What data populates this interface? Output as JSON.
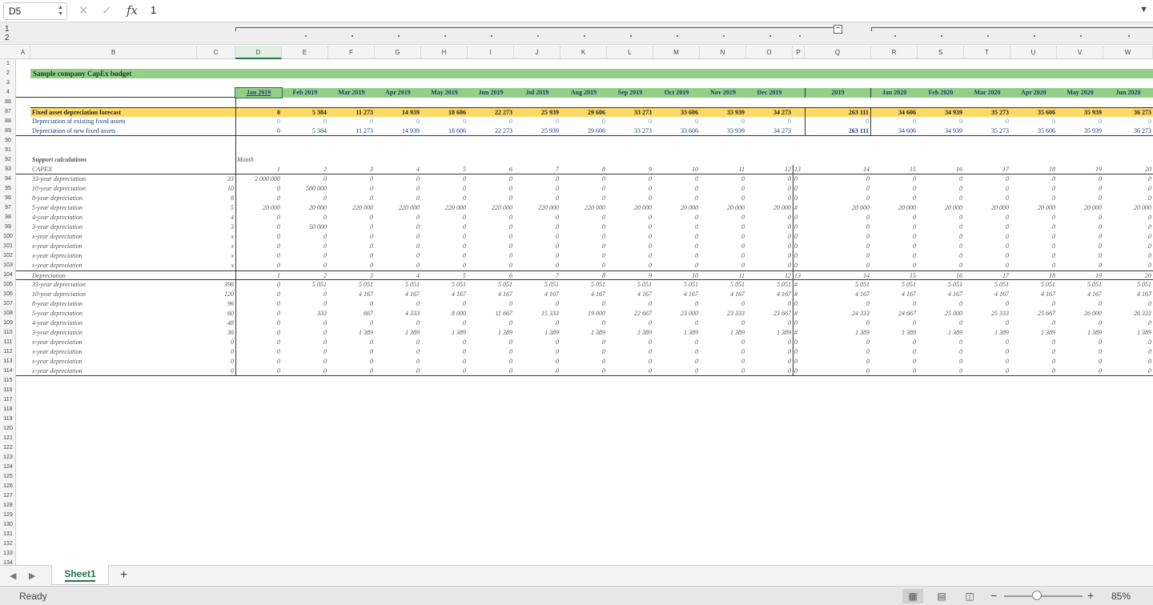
{
  "formula_bar": {
    "name_box": "D5",
    "formula": "1",
    "fx": "fx"
  },
  "outline": {
    "levels": [
      "1",
      "2"
    ],
    "collapse_symbol": "−"
  },
  "columns": [
    "A",
    "B",
    "C",
    "D",
    "E",
    "F",
    "G",
    "H",
    "I",
    "J",
    "K",
    "L",
    "M",
    "N",
    "O",
    "P",
    "Q",
    "R",
    "S",
    "T",
    "U",
    "V",
    "W"
  ],
  "active_column": "D",
  "rows_top": [
    "1",
    "2",
    "3",
    "4"
  ],
  "title": "Sample company CapEx budget",
  "months": [
    "Jan 2019",
    "Feb 2019",
    "Mar 2019",
    "Apr 2019",
    "May 2019",
    "Jun 2019",
    "Jul 2019",
    "Aug 2019",
    "Sep 2019",
    "Oct 2019",
    "Nov 2019",
    "Dec 2019",
    "",
    "2019",
    "Jan 2020",
    "Feb 2020",
    "Mar 2020",
    "Apr 2020",
    "May 2020",
    "Jun 2020"
  ],
  "summary": [
    {
      "row": "87",
      "label": "Fixed asset depreciation forecast",
      "values": [
        "0",
        "5 384",
        "11 273",
        "14 939",
        "18 606",
        "22 273",
        "25 939",
        "29 606",
        "33 273",
        "33 606",
        "33 939",
        "34 273",
        "",
        "263 111",
        "34 606",
        "34 939",
        "35 273",
        "35 606",
        "35 939",
        "36 273"
      ]
    },
    {
      "row": "88",
      "label": "Depreciation of existing fixed assets",
      "values": [
        "0",
        "0",
        "0",
        "0",
        "0",
        "0",
        "0",
        "0",
        "0",
        "0",
        "0",
        "0",
        "",
        "0",
        "0",
        "0",
        "0",
        "0",
        "0",
        "0"
      ]
    },
    {
      "row": "89",
      "label": "Depreciation of new fixed assets",
      "values": [
        "0",
        "5 384",
        "11 273",
        "14 939",
        "18 606",
        "22 273",
        "25 939",
        "29 606",
        "33 273",
        "33 606",
        "33 939",
        "34 273",
        "",
        "263 111",
        "34 606",
        "34 939",
        "35 273",
        "35 606",
        "35 939",
        "36 273"
      ]
    }
  ],
  "support": {
    "header_label": "Support calculations",
    "month_label": "Month",
    "capex_label": "CAPEX",
    "depr_label": "Depreciation",
    "month_numbers": [
      "1",
      "2",
      "3",
      "4",
      "5",
      "6",
      "7",
      "8",
      "9",
      "10",
      "11",
      "12",
      "13",
      "14",
      "15",
      "16",
      "17",
      "18",
      "19",
      "20"
    ],
    "capex_rows": [
      {
        "row": "94",
        "label": "33-year depreciation",
        "c": "33",
        "values": [
          "2 000 000",
          "0",
          "0",
          "0",
          "0",
          "0",
          "0",
          "0",
          "0",
          "0",
          "0",
          "0",
          "0",
          "0",
          "0",
          "0",
          "0",
          "0",
          "0",
          "0"
        ]
      },
      {
        "row": "95",
        "label": "10-year depreciation",
        "c": "10",
        "values": [
          "0",
          "500 000",
          "0",
          "0",
          "0",
          "0",
          "0",
          "0",
          "0",
          "0",
          "0",
          "0",
          "0",
          "0",
          "0",
          "0",
          "0",
          "0",
          "0",
          "0"
        ]
      },
      {
        "row": "96",
        "label": "8-year depreciation",
        "c": "8",
        "values": [
          "0",
          "0",
          "0",
          "0",
          "0",
          "0",
          "0",
          "0",
          "0",
          "0",
          "0",
          "0",
          "0",
          "0",
          "0",
          "0",
          "0",
          "0",
          "0",
          "0"
        ]
      },
      {
        "row": "97",
        "label": "5-year depreciation",
        "c": "5",
        "values": [
          "20 000",
          "20 000",
          "220 000",
          "220 000",
          "220 000",
          "220 000",
          "220 000",
          "220 000",
          "20 000",
          "20 000",
          "20 000",
          "20 000",
          "#",
          "20 000",
          "20 000",
          "20 000",
          "20 000",
          "20 000",
          "20 000",
          "20 000"
        ]
      },
      {
        "row": "98",
        "label": "4-year depreciation",
        "c": "4",
        "values": [
          "0",
          "0",
          "0",
          "0",
          "0",
          "0",
          "0",
          "0",
          "0",
          "0",
          "0",
          "0",
          "0",
          "0",
          "0",
          "0",
          "0",
          "0",
          "0",
          "0"
        ]
      },
      {
        "row": "99",
        "label": "3-year depreciation",
        "c": "3",
        "values": [
          "0",
          "50 000",
          "0",
          "0",
          "0",
          "0",
          "0",
          "0",
          "0",
          "0",
          "0",
          "0",
          "0",
          "0",
          "0",
          "0",
          "0",
          "0",
          "0",
          "0"
        ]
      },
      {
        "row": "100",
        "label": "x-year depreciation",
        "c": "x",
        "values": [
          "0",
          "0",
          "0",
          "0",
          "0",
          "0",
          "0",
          "0",
          "0",
          "0",
          "0",
          "0",
          "0",
          "0",
          "0",
          "0",
          "0",
          "0",
          "0",
          "0"
        ]
      },
      {
        "row": "101",
        "label": "x-year depreciation",
        "c": "x",
        "values": [
          "0",
          "0",
          "0",
          "0",
          "0",
          "0",
          "0",
          "0",
          "0",
          "0",
          "0",
          "0",
          "0",
          "0",
          "0",
          "0",
          "0",
          "0",
          "0",
          "0"
        ]
      },
      {
        "row": "102",
        "label": "x-year depreciation",
        "c": "x",
        "values": [
          "0",
          "0",
          "0",
          "0",
          "0",
          "0",
          "0",
          "0",
          "0",
          "0",
          "0",
          "0",
          "0",
          "0",
          "0",
          "0",
          "0",
          "0",
          "0",
          "0"
        ]
      },
      {
        "row": "103",
        "label": "x-year depreciation",
        "c": "x",
        "values": [
          "0",
          "0",
          "0",
          "0",
          "0",
          "0",
          "0",
          "0",
          "0",
          "0",
          "0",
          "0",
          "0",
          "0",
          "0",
          "0",
          "0",
          "0",
          "0",
          "0"
        ]
      }
    ],
    "depr_rows": [
      {
        "row": "105",
        "label": "33-year depreciation",
        "c": "396",
        "values": [
          "0",
          "5 051",
          "5 051",
          "5 051",
          "5 051",
          "5 051",
          "5 051",
          "5 051",
          "5 051",
          "5 051",
          "5 051",
          "5 051",
          "#",
          "5 051",
          "5 051",
          "5 051",
          "5 051",
          "5 051",
          "5 051",
          "5 051"
        ]
      },
      {
        "row": "106",
        "label": "10-year depreciation",
        "c": "120",
        "values": [
          "0",
          "0",
          "4 167",
          "4 167",
          "4 167",
          "4 167",
          "4 167",
          "4 167",
          "4 167",
          "4 167",
          "4 167",
          "4 167",
          "#",
          "4 167",
          "4 167",
          "4 167",
          "4 167",
          "4 167",
          "4 167",
          "4 167"
        ]
      },
      {
        "row": "107",
        "label": "8-year depreciation",
        "c": "96",
        "values": [
          "0",
          "0",
          "0",
          "0",
          "0",
          "0",
          "0",
          "0",
          "0",
          "0",
          "0",
          "0",
          "0",
          "0",
          "0",
          "0",
          "0",
          "0",
          "0",
          "0"
        ]
      },
      {
        "row": "108",
        "label": "5-year depreciation",
        "c": "60",
        "values": [
          "0",
          "333",
          "667",
          "4 333",
          "8 000",
          "11 667",
          "15 333",
          "19 000",
          "22 667",
          "23 000",
          "23 333",
          "23 667",
          "#",
          "24 333",
          "24 667",
          "25 000",
          "25 333",
          "25 667",
          "26 000",
          "26 333"
        ]
      },
      {
        "row": "109",
        "label": "4-year depreciation",
        "c": "48",
        "values": [
          "0",
          "0",
          "0",
          "0",
          "0",
          "0",
          "0",
          "0",
          "0",
          "0",
          "0",
          "0",
          "0",
          "0",
          "0",
          "0",
          "0",
          "0",
          "0",
          "0"
        ]
      },
      {
        "row": "110",
        "label": "3-year depreciation",
        "c": "36",
        "values": [
          "0",
          "0",
          "1 389",
          "1 389",
          "1 389",
          "1 389",
          "1 389",
          "1 389",
          "1 389",
          "1 389",
          "1 389",
          "1 389",
          "#",
          "1 389",
          "1 389",
          "1 389",
          "1 389",
          "1 389",
          "1 389",
          "1 389"
        ]
      },
      {
        "row": "111",
        "label": "x-year depreciation",
        "c": "0",
        "values": [
          "0",
          "0",
          "0",
          "0",
          "0",
          "0",
          "0",
          "0",
          "0",
          "0",
          "0",
          "0",
          "0",
          "0",
          "0",
          "0",
          "0",
          "0",
          "0",
          "0"
        ]
      },
      {
        "row": "112",
        "label": "x-year depreciation",
        "c": "0",
        "values": [
          "0",
          "0",
          "0",
          "0",
          "0",
          "0",
          "0",
          "0",
          "0",
          "0",
          "0",
          "0",
          "0",
          "0",
          "0",
          "0",
          "0",
          "0",
          "0",
          "0"
        ]
      },
      {
        "row": "113",
        "label": "x-year depreciation",
        "c": "0",
        "values": [
          "0",
          "0",
          "0",
          "0",
          "0",
          "0",
          "0",
          "0",
          "0",
          "0",
          "0",
          "0",
          "0",
          "0",
          "0",
          "0",
          "0",
          "0",
          "0",
          "0"
        ]
      },
      {
        "row": "114",
        "label": "x-year depreciation",
        "c": "0",
        "values": [
          "0",
          "0",
          "0",
          "0",
          "0",
          "0",
          "0",
          "0",
          "0",
          "0",
          "0",
          "0",
          "0",
          "0",
          "0",
          "0",
          "0",
          "0",
          "0",
          "0"
        ]
      }
    ]
  },
  "empty_rows": [
    "86",
    "90",
    "91",
    "115",
    "116",
    "117",
    "118",
    "119",
    "120",
    "121",
    "122",
    "123",
    "124",
    "125",
    "126",
    "127",
    "128",
    "129",
    "130",
    "131",
    "132",
    "133",
    "134"
  ],
  "sheet_tabs": [
    "Sheet1"
  ],
  "add_sheet": "+",
  "status": "Ready",
  "zoom": "85%",
  "zoom_level_percent": 85,
  "colors": {
    "accent": "#217346",
    "band_green": "#93cf87",
    "band_yellow": "#ffd966"
  }
}
